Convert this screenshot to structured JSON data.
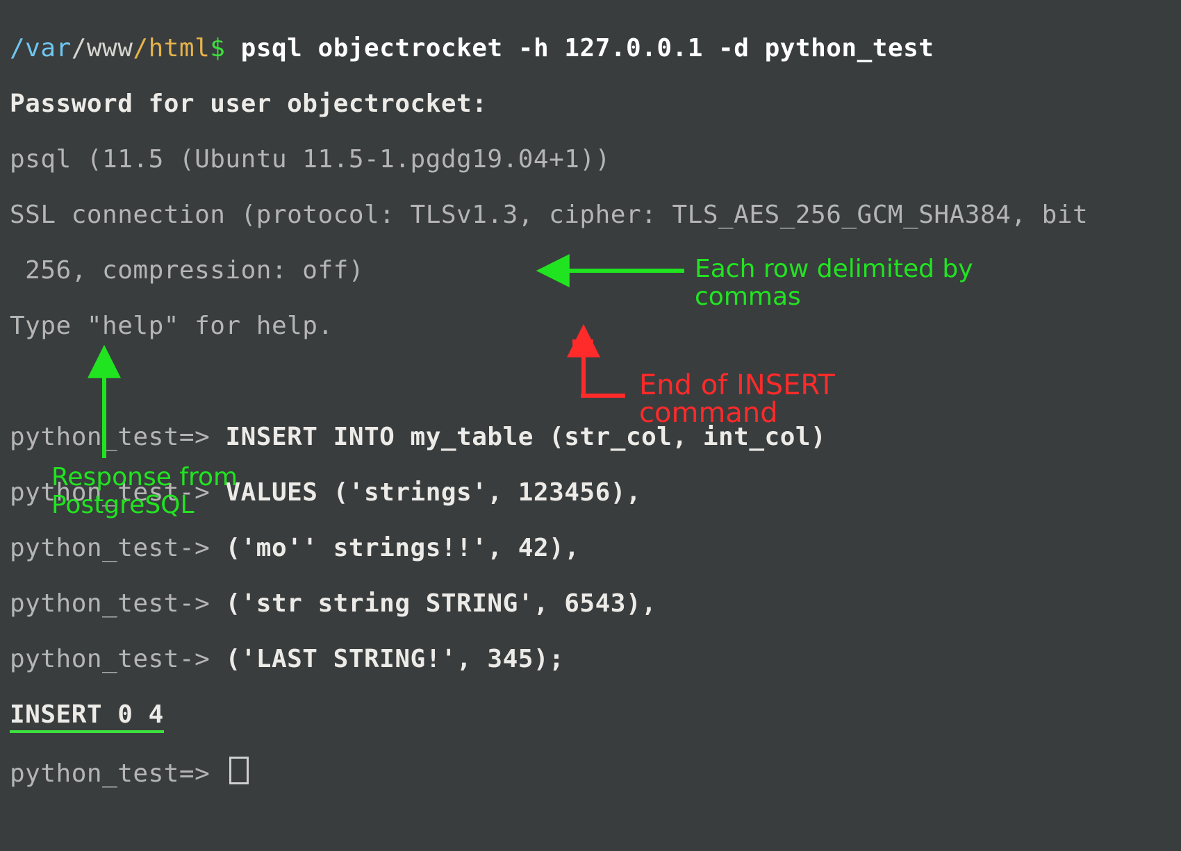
{
  "prompt": {
    "path_var": "/var",
    "path_www": "/www",
    "path_html": "/html",
    "dollar": "$"
  },
  "command": "psql objectrocket -h 127.0.0.1 -d python_test",
  "password_line": "Password for user objectrocket:",
  "psql_version": "psql (11.5 (Ubuntu 11.5-1.pgdg19.04+1))",
  "ssl_line1": "SSL connection (protocol: TLSv1.3, cipher: TLS_AES_256_GCM_SHA384, bit",
  "ssl_line2": " 256, compression: off)",
  "help_line": "Type \"help\" for help.",
  "sql": {
    "p1": "python_test=> ",
    "p2": "python_test-> ",
    "l1": "INSERT INTO my_table (str_col, int_col)",
    "l2": "VALUES ('strings', 123456),",
    "l3": "('mo'' strings!!', 42),",
    "l4": "('str string STRING', 6543),",
    "l5": "('LAST STRING!', 345);"
  },
  "response": "INSERT 0 4",
  "annotations": {
    "rows_delimited": "Each row delimited by\ncommas",
    "end_of_insert": "End of INSERT\ncommand",
    "response_from": "Response from\nPostgreSQL"
  }
}
